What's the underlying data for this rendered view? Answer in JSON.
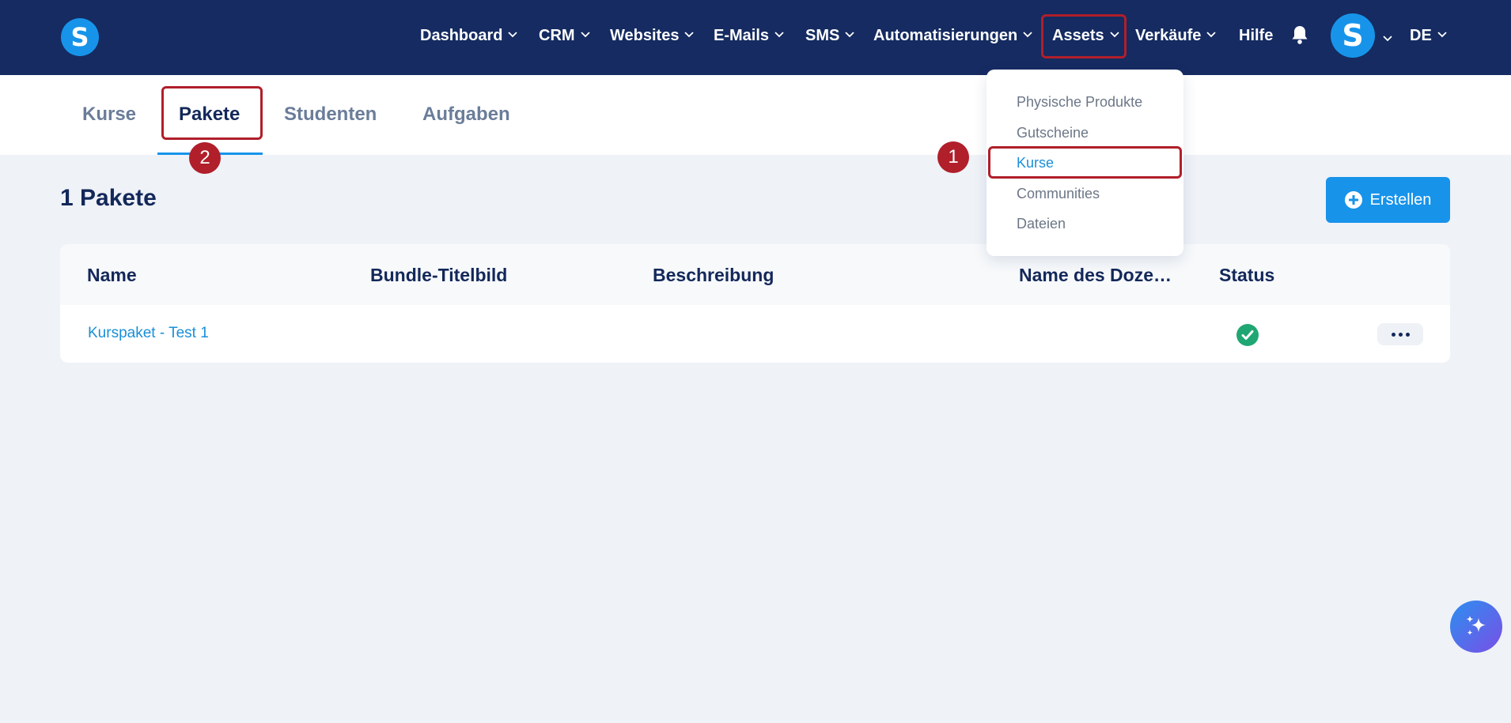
{
  "brand": {
    "logo_letter": "S",
    "colors": {
      "nav_bg": "#152b61",
      "accent": "#1794ea",
      "annotation": "#b01f2a",
      "success": "#1fa773"
    }
  },
  "nav": {
    "items": [
      {
        "label": "Dashboard",
        "has_dropdown": true
      },
      {
        "label": "CRM",
        "has_dropdown": true
      },
      {
        "label": "Websites",
        "has_dropdown": true
      },
      {
        "label": "E-Mails",
        "has_dropdown": true
      },
      {
        "label": "SMS",
        "has_dropdown": true
      },
      {
        "label": "Automatisierungen",
        "has_dropdown": true
      },
      {
        "label": "Assets",
        "has_dropdown": true,
        "highlighted": true
      },
      {
        "label": "Verkäufe",
        "has_dropdown": true
      },
      {
        "label": "Hilfe",
        "has_dropdown": false
      }
    ],
    "notification_icon": "bell-icon",
    "avatar_letter": "S",
    "language": "DE"
  },
  "assets_dropdown": {
    "items": [
      {
        "label": "Physische Produkte"
      },
      {
        "label": "Gutscheine"
      },
      {
        "label": "Kurse",
        "active": true
      },
      {
        "label": "Communities"
      },
      {
        "label": "Dateien"
      }
    ]
  },
  "tabs": [
    {
      "label": "Kurse"
    },
    {
      "label": "Pakete",
      "active": true
    },
    {
      "label": "Studenten"
    },
    {
      "label": "Aufgaben"
    }
  ],
  "annotations": {
    "step1": "1",
    "step2": "2"
  },
  "main": {
    "title": "1 Pakete",
    "create_button": "Erstellen",
    "table": {
      "columns": [
        "Name",
        "Bundle-Titelbild",
        "Beschreibung",
        "Name des Doze…",
        "Status"
      ],
      "rows": [
        {
          "name": "Kurspaket - Test 1",
          "status": "active"
        }
      ]
    }
  },
  "fab_icon": "sparkles-icon"
}
